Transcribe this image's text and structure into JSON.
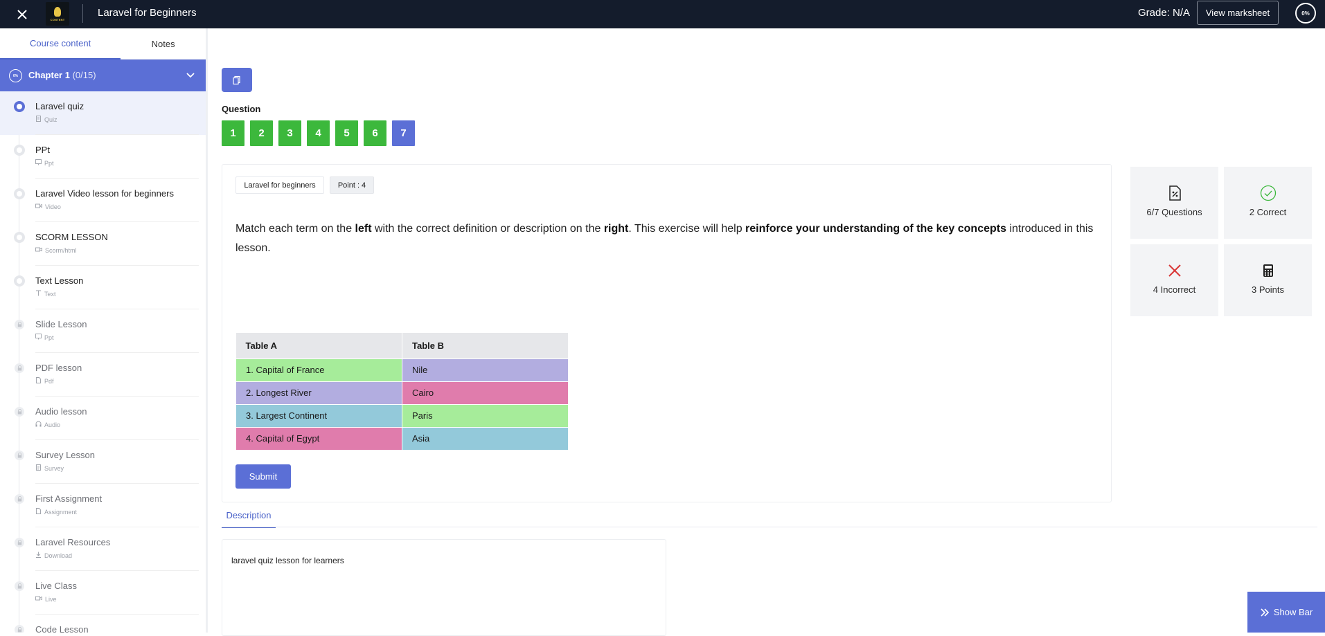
{
  "header": {
    "course_title": "Laravel for Beginners",
    "logo_text": "CONTENT",
    "grade": "Grade: N/A",
    "marksheet_label": "View marksheet",
    "progress": "0%"
  },
  "sidebar": {
    "tabs": [
      {
        "label": "Course content",
        "active": true
      },
      {
        "label": "Notes",
        "active": false
      }
    ],
    "chapter": {
      "progress": "0%",
      "title": "Chapter 1",
      "count": "(0/15)"
    },
    "lessons": [
      {
        "name": "Laravel quiz",
        "type": "Quiz",
        "icon": "quiz-icon",
        "state": "active"
      },
      {
        "name": "PPt",
        "type": "Ppt",
        "icon": "slides-icon",
        "state": "open"
      },
      {
        "name": "Laravel Video lesson for beginners",
        "type": "Video",
        "icon": "video-icon",
        "state": "open"
      },
      {
        "name": "SCORM LESSON",
        "type": "Scorm/html",
        "icon": "video-icon",
        "state": "open"
      },
      {
        "name": "Text Lesson",
        "type": "Text",
        "icon": "text-icon",
        "state": "open"
      },
      {
        "name": "Slide Lesson",
        "type": "Ppt",
        "icon": "slides-icon",
        "state": "locked"
      },
      {
        "name": "PDF lesson",
        "type": "Pdf",
        "icon": "file-icon",
        "state": "locked"
      },
      {
        "name": "Audio lesson",
        "type": "Audio",
        "icon": "headphones-icon",
        "state": "locked"
      },
      {
        "name": "Survey Lesson",
        "type": "Survey",
        "icon": "survey-icon",
        "state": "locked"
      },
      {
        "name": "First Assignment",
        "type": "Assignment",
        "icon": "file-icon",
        "state": "locked"
      },
      {
        "name": "Laravel Resources",
        "type": "Download",
        "icon": "download-icon",
        "state": "locked"
      },
      {
        "name": "Live Class",
        "type": "Live",
        "icon": "video-icon",
        "state": "locked"
      },
      {
        "name": "Code Lesson",
        "type": "",
        "icon": "code-icon",
        "state": "locked"
      }
    ]
  },
  "quiz": {
    "question_label": "Question",
    "numbers": [
      {
        "label": "1",
        "state": "answered"
      },
      {
        "label": "2",
        "state": "answered"
      },
      {
        "label": "3",
        "state": "answered"
      },
      {
        "label": "4",
        "state": "answered"
      },
      {
        "label": "5",
        "state": "answered"
      },
      {
        "label": "6",
        "state": "answered"
      },
      {
        "label": "7",
        "state": "current"
      }
    ],
    "course_chip": "Laravel for beginners",
    "points_chip": "Point : 4",
    "text_parts": [
      {
        "t": "Match each term on the ",
        "b": false
      },
      {
        "t": "left",
        "b": true
      },
      {
        "t": " with the correct definition or description on the ",
        "b": false
      },
      {
        "t": "right",
        "b": true
      },
      {
        "t": ". This exercise will help ",
        "b": false
      },
      {
        "t": "reinforce your understanding of the key concepts",
        "b": true
      },
      {
        "t": " introduced in this lesson.",
        "b": false
      }
    ],
    "table": {
      "header_a": "Table A",
      "header_b": "Table B",
      "rows": [
        {
          "a": "1. Capital of France",
          "a_color": "#a6ec9a",
          "b": "Nile",
          "b_color": "#b2ade0"
        },
        {
          "a": "2. Longest River",
          "a_color": "#b2ade0",
          "b": "Cairo",
          "b_color": "#e07cac"
        },
        {
          "a": "3. Largest Continent",
          "a_color": "#93c9da",
          "b": "Paris",
          "b_color": "#a6ec9a"
        },
        {
          "a": "4. Capital of Egypt",
          "a_color": "#e07cac",
          "b": "Asia",
          "b_color": "#93c9da"
        }
      ]
    },
    "submit_label": "Submit"
  },
  "stats": [
    {
      "label": "6/7 Questions",
      "icon": "percent-file-icon"
    },
    {
      "label": "2 Correct",
      "icon": "check-circle-icon"
    },
    {
      "label": "4 Incorrect",
      "icon": "x-icon"
    },
    {
      "label": "3 Points",
      "icon": "calculator-icon"
    }
  ],
  "description": {
    "tab_label": "Description",
    "text": "laravel quiz lesson for learners"
  },
  "show_bar_label": "Show Bar",
  "colors": {
    "accent": "#5b6fd6",
    "answered": "#3cb83c",
    "topbar": "#141c2c",
    "correct": "#3cb83c",
    "incorrect": "#d93636"
  }
}
